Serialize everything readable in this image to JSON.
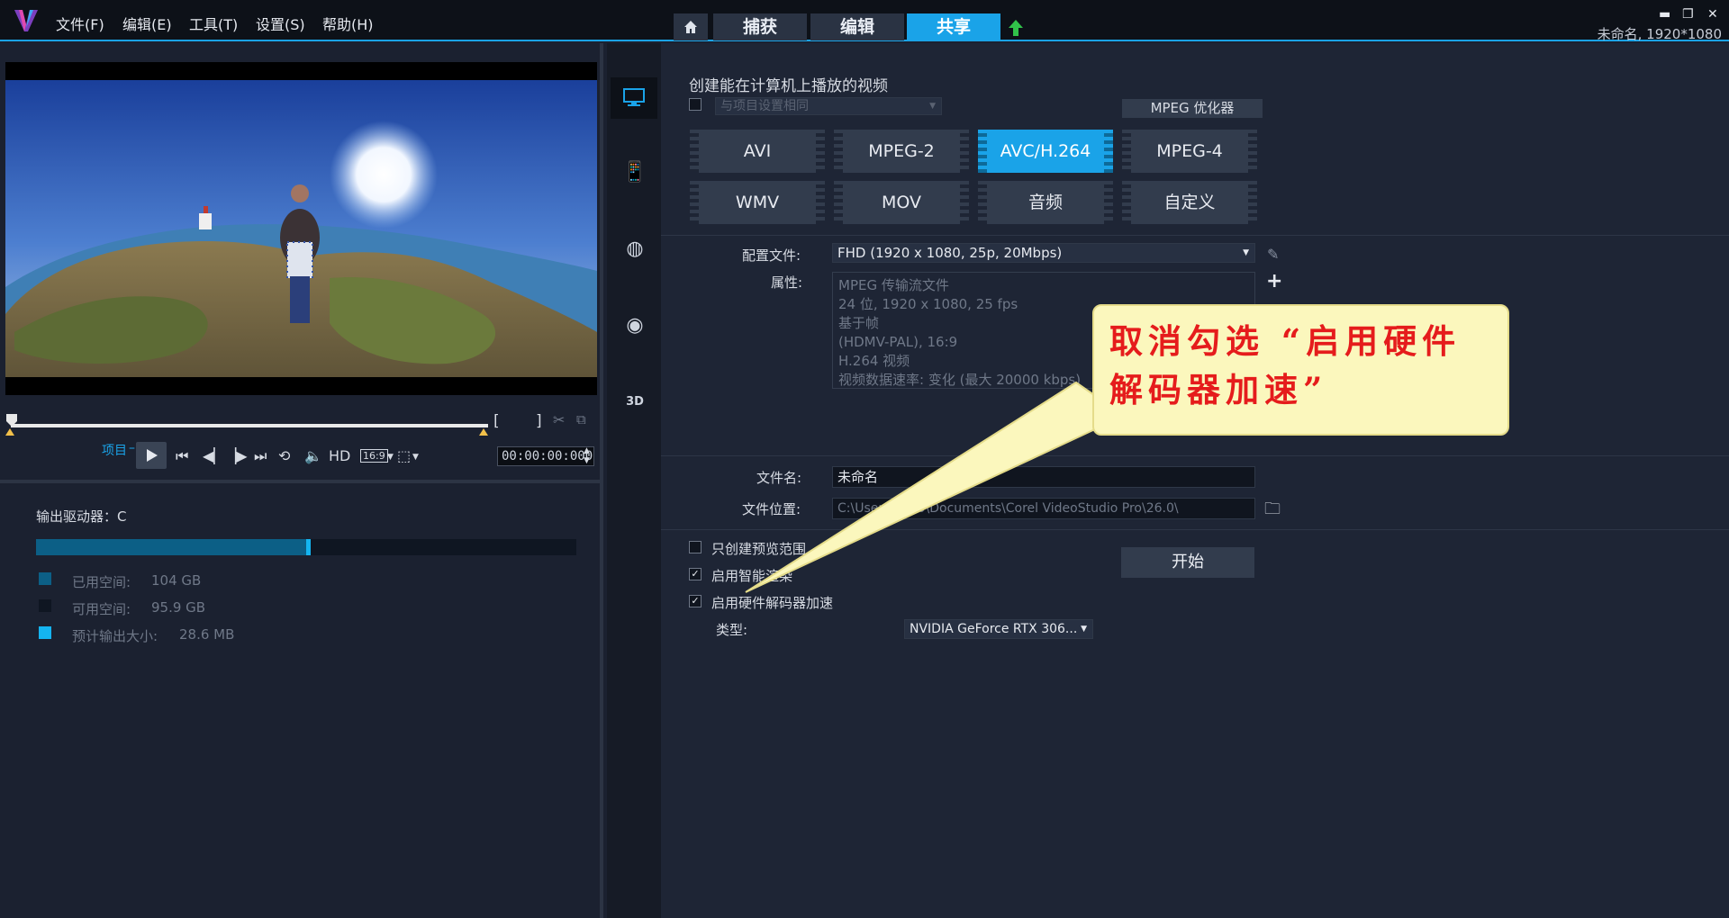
{
  "menu": {
    "file": "文件(F)",
    "edit": "编辑(E)",
    "tools": "工具(T)",
    "settings": "设置(S)",
    "help": "帮助(H)"
  },
  "tabs": {
    "home_icon": "home-icon",
    "capture": "捕获",
    "edit": "编辑",
    "share": "共享",
    "upload_icon": "upload-arrow-icon"
  },
  "project_info": "未命名, 1920*1080",
  "player": {
    "mode_label": "项目",
    "hd_label": "HD",
    "aspect_label": "16:9",
    "timecode": "00:00:00:000"
  },
  "drive": {
    "title": "输出驱动器：C",
    "used_fraction": 0.5,
    "used_label": "已用空间:",
    "used_value": "104 GB",
    "free_label": "可用空间:",
    "free_value": "95.9 GB",
    "estimate_label": "预计输出大小:",
    "estimate_value": "28.6 MB",
    "colors": {
      "used": "#0c5f86",
      "free": "#0f1622",
      "estimate": "#14b4f0"
    }
  },
  "share": {
    "heading": "创建能在计算机上播放的视频",
    "same_as_project": "与项目设置相同",
    "mpeg_optimizer": "MPEG 优化器",
    "formats": [
      "AVI",
      "MPEG-2",
      "AVC/H.264",
      "MPEG-4",
      "WMV",
      "MOV",
      "音频",
      "自定义"
    ],
    "active_format": "AVC/H.264",
    "profile_label": "配置文件:",
    "profile_value": "FHD (1920 x 1080, 25p, 20Mbps)",
    "properties_label": "属性:",
    "properties": [
      "MPEG 传输流文件",
      "24 位, 1920 x 1080, 25 fps",
      "基于帧",
      "(HDMV-PAL),  16:9",
      "H.264 视频",
      "视频数据速率: 变化 (最大 20000 kbps)"
    ],
    "filename_label": "文件名:",
    "filename_value": "未命名",
    "location_label": "文件位置:",
    "location_value": "C:\\Users\\xx20\\Documents\\Corel VideoStudio Pro\\26.0\\",
    "opt_preview_only": "只创建预览范围",
    "opt_smart_render": "启用智能渲染",
    "opt_hw_decoder": "启用硬件解码器加速",
    "type_label": "类型:",
    "type_value": "NVIDIA GeForce RTX 306...",
    "start_button": "开始"
  },
  "annotation": "取消勾选 “启用硬件解码器加速”"
}
